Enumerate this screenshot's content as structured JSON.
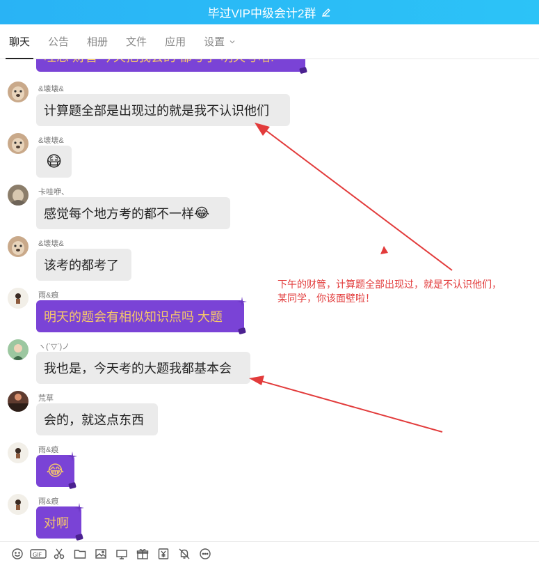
{
  "window": {
    "title": "毕过VIP中级会计2群"
  },
  "tabs": [
    {
      "label": "聊天",
      "active": true
    },
    {
      "label": "公告"
    },
    {
      "label": "相册"
    },
    {
      "label": "文件"
    },
    {
      "label": "应用"
    },
    {
      "label": "设置"
    }
  ],
  "messages": [
    {
      "text": "哇思 财管 今天把我会的 都考了 明天考啥!"
    },
    {
      "sender": "&壊壊&",
      "text": "计算题全部是出现过的就是我不认识他们"
    },
    {
      "sender": "&壊壊&",
      "emoji": "😷"
    },
    {
      "sender": "卡哇咿、",
      "text": "感觉每个地方考的都不一样",
      "emoji": "😂"
    },
    {
      "sender": "&壊壊&",
      "text": "该考的都考了"
    },
    {
      "sender": "雨&痕",
      "text": "明天的题会有相似知识点吗 大题"
    },
    {
      "sender": "ヽ(ˋ▽ˊ)ノ",
      "text": "我也是，今天考的大题我都基本会"
    },
    {
      "sender": "荒草",
      "text": "会的，就这点东西"
    },
    {
      "sender": "雨&痕",
      "emoji": "😂"
    },
    {
      "sender": "雨&痕",
      "text": "对啊"
    }
  ],
  "annotation": {
    "text": "下午的财管，计算题全部出现过，就是不认识他们，某同学，你该面壁啦！",
    "color": "#e23b3b"
  },
  "toolbar_icons": [
    "emoji-icon",
    "gif-icon",
    "scissors-icon",
    "folder-icon",
    "image-icon",
    "screen-icon",
    "gift-icon",
    "yen-icon",
    "bell-off-icon",
    "more-icon"
  ],
  "colors": {
    "title_bar": "#29b3f5",
    "vip_bubble": "#7a43d6",
    "vip_text": "#f6c76a",
    "bubble": "#ebebeb",
    "arrow": "#e23b3b"
  }
}
